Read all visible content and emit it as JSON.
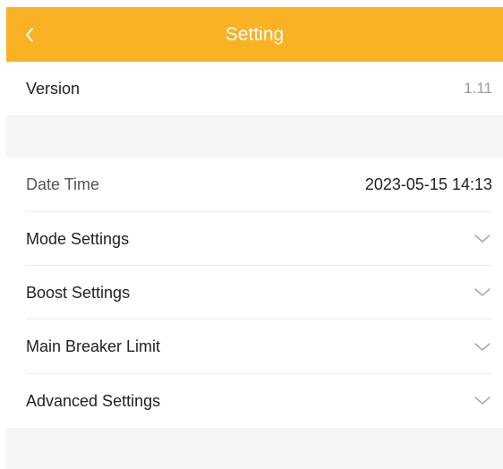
{
  "header": {
    "title": "Setting",
    "back_icon": "chevron-left-icon",
    "background": "#F9B224"
  },
  "version": {
    "label": "Version",
    "value": "1.11"
  },
  "date_time": {
    "label": "Date Time",
    "value": "2023-05-15 14:13"
  },
  "sections": [
    {
      "label": "Mode Settings",
      "icon": "chevron-down-icon"
    },
    {
      "label": "Boost Settings",
      "icon": "chevron-down-icon"
    },
    {
      "label": "Main Breaker Limit",
      "icon": "chevron-down-icon"
    },
    {
      "label": "Advanced Settings",
      "icon": "chevron-down-icon"
    }
  ]
}
